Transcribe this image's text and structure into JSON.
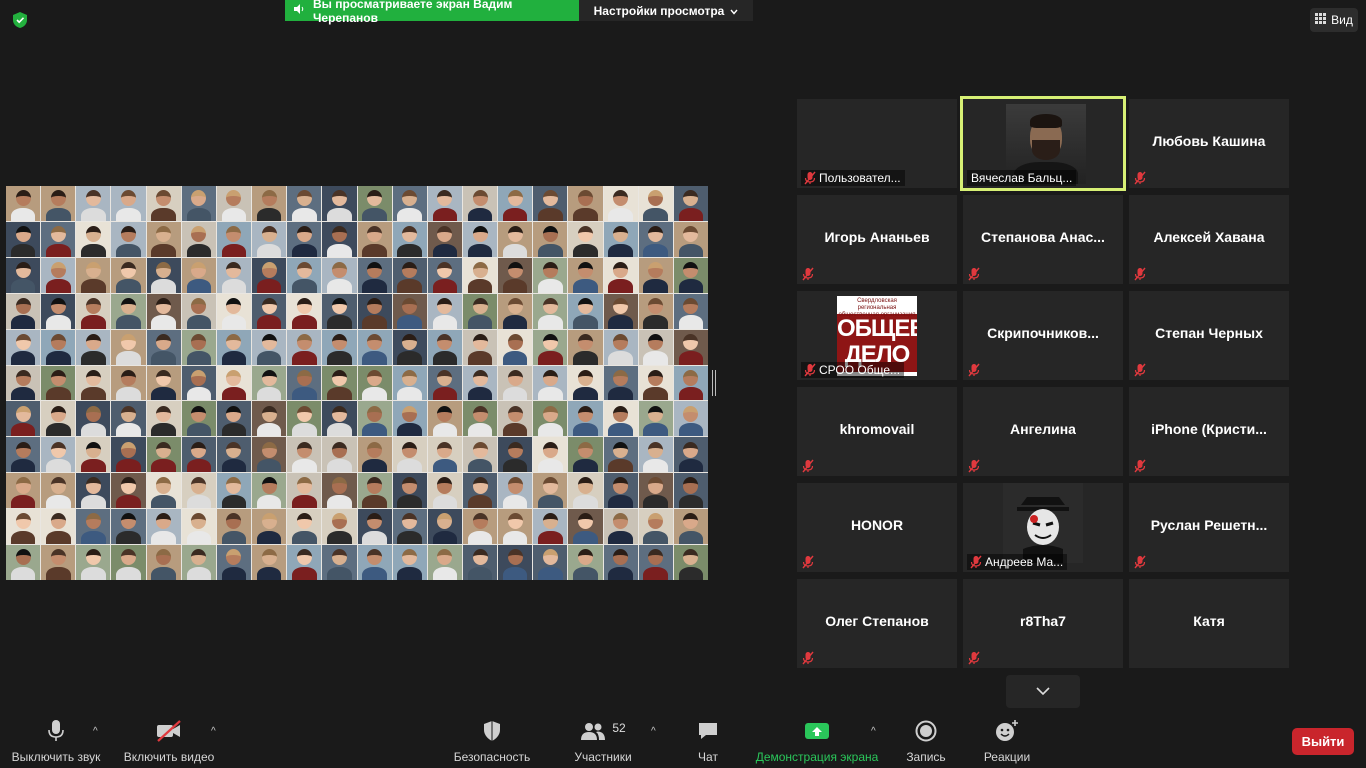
{
  "top": {
    "share_banner": "Вы просматриваете экран Вадим Черепанов",
    "view_options": "Настройки просмотра",
    "view_button": "Вид"
  },
  "participants": [
    {
      "name": "Пользовател...",
      "style": "label",
      "muted": true
    },
    {
      "name": "Вячеслав Бальц...",
      "style": "photo",
      "muted": false,
      "active": true
    },
    {
      "name": "Любовь Кашина",
      "style": "name",
      "muted": true
    },
    {
      "name": "Игорь Ананьев",
      "style": "name",
      "muted": true
    },
    {
      "name": "Степанова Анас...",
      "style": "name",
      "muted": true
    },
    {
      "name": "Алексей Хавана",
      "style": "name",
      "muted": true
    },
    {
      "name": "СРОО Обще...",
      "style": "logo",
      "muted": true
    },
    {
      "name": "Скрипочников...",
      "style": "name",
      "muted": true
    },
    {
      "name": "Степан Черных",
      "style": "name",
      "muted": true
    },
    {
      "name": "khromovail",
      "style": "name",
      "muted": true
    },
    {
      "name": "Ангелина",
      "style": "name",
      "muted": true
    },
    {
      "name": "iPhone (Кристи...",
      "style": "name",
      "muted": true
    },
    {
      "name": "HONOR",
      "style": "name",
      "muted": true
    },
    {
      "name": "Андреев Ма...",
      "style": "anon",
      "muted": true
    },
    {
      "name": "Руслан Решетн...",
      "style": "name",
      "muted": true
    },
    {
      "name": "Олег Степанов",
      "style": "name",
      "muted": true
    },
    {
      "name": "r8Tha7",
      "style": "name",
      "muted": true
    },
    {
      "name": "Катя",
      "style": "name",
      "muted": false
    }
  ],
  "logo_tile": {
    "small_text": "Свердловская региональная общественная организация",
    "big_text": "ОБЩЕЕ ДЕЛО"
  },
  "toolbar": {
    "mute": "Выключить звук",
    "video": "Включить видео",
    "security": "Безопасность",
    "participants": "Участники",
    "participants_count": "52",
    "chat": "Чат",
    "share": "Демонстрация экрана",
    "record": "Запись",
    "reactions": "Реакции",
    "leave": "Выйти"
  },
  "colors": {
    "banner_green": "#21b03e",
    "share_green": "#2ac65a",
    "active_speaker": "#d7f075",
    "mute_red": "#e0393e",
    "leave_red": "#c9252c"
  }
}
